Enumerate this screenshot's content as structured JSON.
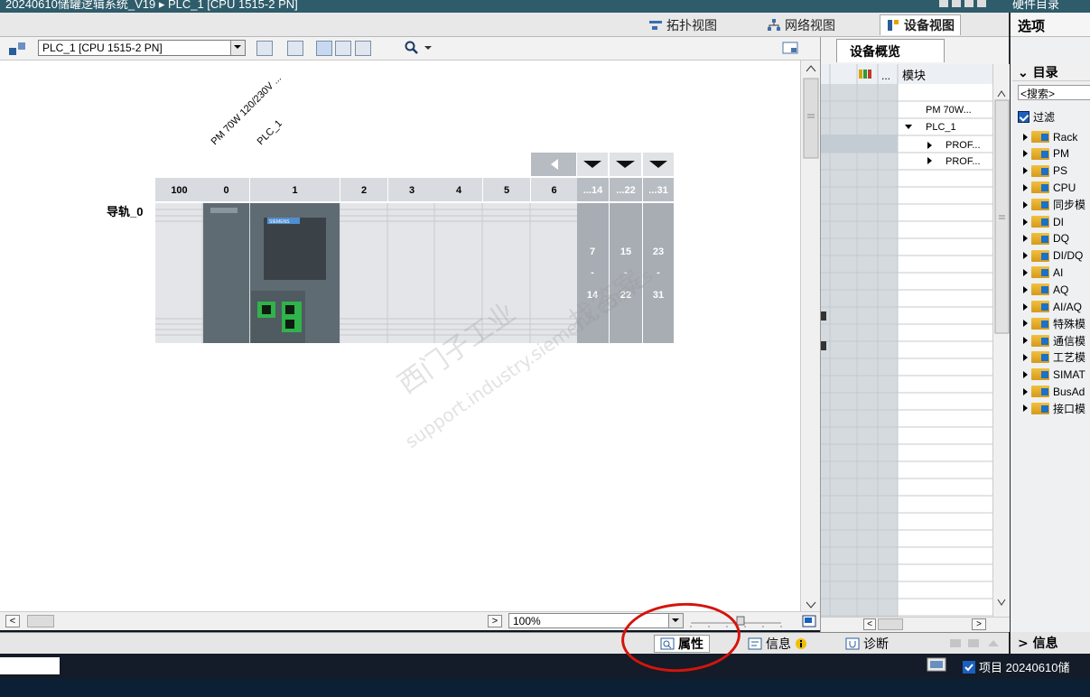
{
  "window": {
    "title_fragment": "20240610储罐逻辑系统_V19 ▸ PLC_1 [CPU 1515-2 PN]",
    "right_title_fragment": "硬件目录"
  },
  "view_tabs": {
    "topology": "拓扑视图",
    "network": "网络视图",
    "device": "设备视图"
  },
  "options_panel": {
    "title": "选项",
    "catalog_header": "目录",
    "search_placeholder": "<搜索>",
    "filter_label": "过滤",
    "catalog_items": [
      "Rack",
      "PM",
      "PS",
      "CPU",
      "同步模",
      "DI",
      "DQ",
      "DI/DQ",
      "AI",
      "AQ",
      "AI/AQ",
      "特殊模",
      "通信模",
      "工艺模",
      "SIMAT",
      "BusAd",
      "接口模"
    ]
  },
  "toolbar": {
    "device_select": "PLC_1 [CPU 1515-2 PN]"
  },
  "rack": {
    "rail_label": "导轨_0",
    "module_label_pm": "PM 70W 120/230V ...",
    "module_label_plc": "PLC_1",
    "slots": [
      "100",
      "0",
      "1",
      "2",
      "3",
      "4",
      "5",
      "6",
      "...14",
      "...22",
      "...31"
    ],
    "extra_slot_ranges": [
      {
        "top": "7",
        "mid": "-",
        "bottom": "14"
      },
      {
        "top": "15",
        "mid": "-",
        "bottom": "22"
      },
      {
        "top": "23",
        "mid": "-",
        "bottom": "31"
      }
    ],
    "cpu_brand": "SIEMENS"
  },
  "zoom": {
    "value": "100%"
  },
  "device_overview": {
    "tab_label": "设备概览",
    "column_dots": "...",
    "column_module": "模块",
    "rows": [
      "PM 70W...",
      "PLC_1",
      "PROF...",
      "PROF..."
    ]
  },
  "watermark": {
    "line1": "西门子工业",
    "line2": "support.industry.siemens.com/cs",
    "line3": "找答案"
  },
  "bottom_tabs": {
    "properties": "属性",
    "info": "信息",
    "diagnostics": "诊断",
    "right_info": "信息"
  },
  "status": {
    "project": "项目 20240610储"
  },
  "colors": {
    "title_bar": "#2e5c6b",
    "module_gray": "#5f6b73",
    "annotation_red": "#d4140c",
    "accent_blue": "#1b70c8"
  }
}
